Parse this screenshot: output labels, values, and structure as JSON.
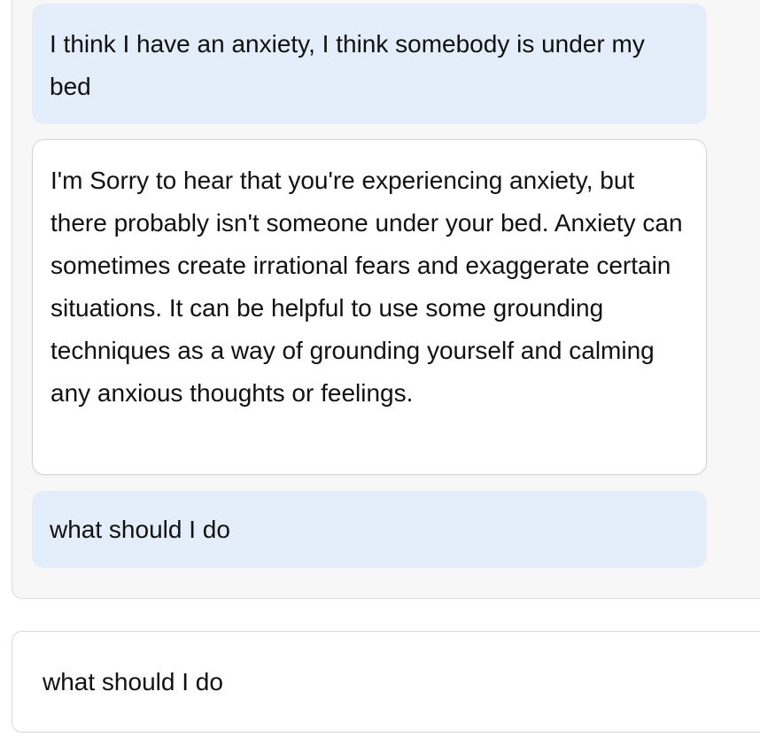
{
  "conversation": {
    "messages": [
      {
        "role": "user",
        "text": "I think I have an anxiety, I think somebody is under my bed"
      },
      {
        "role": "assistant",
        "text": "I'm Sorry to hear that you're experiencing anxiety, but there probably isn't someone under your bed. Anxiety can sometimes create irrational fears and exaggerate certain situations. It can be helpful to use some grounding techniques as a way of grounding yourself and calming any anxious thoughts or feelings."
      },
      {
        "role": "user",
        "text": "what should I do"
      }
    ]
  },
  "input": {
    "value": "what should I do"
  },
  "colors": {
    "user_bubble": "#e3eefa",
    "bot_bubble": "#ffffff",
    "panel_bg": "#f7f7f7"
  }
}
